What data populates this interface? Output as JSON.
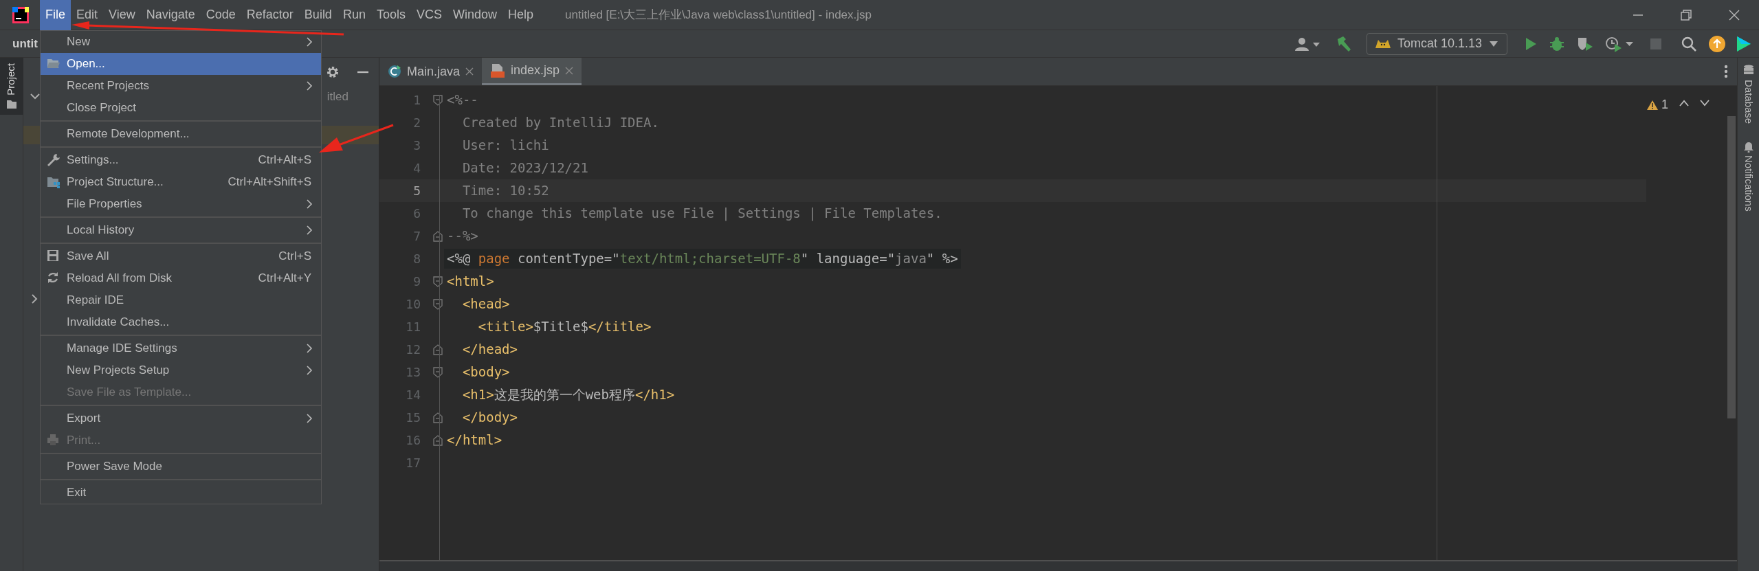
{
  "title_bar": {
    "menus": [
      {
        "label": "File",
        "selected": true
      },
      {
        "label": "Edit",
        "selected": false
      },
      {
        "label": "View",
        "selected": false
      },
      {
        "label": "Navigate",
        "selected": false
      },
      {
        "label": "Code",
        "selected": false
      },
      {
        "label": "Refactor",
        "selected": false
      },
      {
        "label": "Build",
        "selected": false
      },
      {
        "label": "Run",
        "selected": false
      },
      {
        "label": "Tools",
        "selected": false
      },
      {
        "label": "VCS",
        "selected": false
      },
      {
        "label": "Window",
        "selected": false
      },
      {
        "label": "Help",
        "selected": false
      }
    ],
    "title": "untitled [E:\\大三上作业\\Java web\\class1\\untitled] - index.jsp"
  },
  "toolbar": {
    "project_name": "untit",
    "run_config": "Tomcat 10.1.13"
  },
  "left_strip": {
    "label": "Project"
  },
  "project_panel": {
    "visible_text": "itled"
  },
  "tabs": [
    {
      "label": "Main.java",
      "kind": "java",
      "selected": false
    },
    {
      "label": "index.jsp",
      "kind": "jsp",
      "selected": true
    }
  ],
  "editor": {
    "warning_count": "1",
    "lines": [
      {
        "number": "1",
        "current": false,
        "shaded": false,
        "fold_start": true,
        "fold_end": false,
        "tokens": [
          {
            "kind": "comment",
            "text": "<%--"
          }
        ]
      },
      {
        "number": "2",
        "current": false,
        "shaded": false,
        "fold_start": false,
        "fold_end": false,
        "tokens": [
          {
            "kind": "comment",
            "text": "  Created by IntelliJ IDEA."
          }
        ]
      },
      {
        "number": "3",
        "current": false,
        "shaded": false,
        "fold_start": false,
        "fold_end": false,
        "tokens": [
          {
            "kind": "comment",
            "text": "  User: lichi"
          }
        ]
      },
      {
        "number": "4",
        "current": false,
        "shaded": false,
        "fold_start": false,
        "fold_end": false,
        "tokens": [
          {
            "kind": "comment",
            "text": "  Date: 2023/12/21"
          }
        ]
      },
      {
        "number": "5",
        "current": true,
        "shaded": false,
        "fold_start": false,
        "fold_end": false,
        "tokens": [
          {
            "kind": "comment",
            "text": "  Time: 10:52"
          }
        ]
      },
      {
        "number": "6",
        "current": false,
        "shaded": false,
        "fold_start": false,
        "fold_end": false,
        "tokens": [
          {
            "kind": "comment",
            "text": "  To change this template use File | Settings | File Templates."
          }
        ]
      },
      {
        "number": "7",
        "current": false,
        "shaded": false,
        "fold_start": false,
        "fold_end": true,
        "tokens": [
          {
            "kind": "comment",
            "text": "--%>"
          }
        ]
      },
      {
        "number": "8",
        "current": false,
        "shaded": true,
        "fold_start": false,
        "fold_end": false,
        "tokens": [
          {
            "kind": "plain",
            "text": "<%@ "
          },
          {
            "kind": "keyword",
            "text": "page"
          },
          {
            "kind": "plain",
            "text": " contentType=\""
          },
          {
            "kind": "string",
            "text": "text/html;charset=UTF-8"
          },
          {
            "kind": "plain",
            "text": "\" language=\""
          },
          {
            "kind": "muted",
            "text": "java"
          },
          {
            "kind": "plain",
            "text": "\" %>"
          }
        ]
      },
      {
        "number": "9",
        "current": false,
        "shaded": false,
        "fold_start": true,
        "fold_end": false,
        "tokens": [
          {
            "kind": "tag",
            "text": "<html>"
          }
        ]
      },
      {
        "number": "10",
        "current": false,
        "shaded": false,
        "fold_start": true,
        "fold_end": false,
        "tokens": [
          {
            "kind": "tag",
            "text": "  <head>"
          }
        ]
      },
      {
        "number": "11",
        "current": false,
        "shaded": false,
        "fold_start": false,
        "fold_end": false,
        "tokens": [
          {
            "kind": "tag",
            "text": "    <title>"
          },
          {
            "kind": "plain",
            "text": "$Title$"
          },
          {
            "kind": "tag",
            "text": "</title>"
          }
        ]
      },
      {
        "number": "12",
        "current": false,
        "shaded": false,
        "fold_start": false,
        "fold_end": true,
        "tokens": [
          {
            "kind": "tag",
            "text": "  </head>"
          }
        ]
      },
      {
        "number": "13",
        "current": false,
        "shaded": false,
        "fold_start": true,
        "fold_end": false,
        "tokens": [
          {
            "kind": "tag",
            "text": "  <body>"
          }
        ]
      },
      {
        "number": "14",
        "current": false,
        "shaded": false,
        "fold_start": false,
        "fold_end": false,
        "tokens": [
          {
            "kind": "tag",
            "text": "  <h1>"
          },
          {
            "kind": "plain",
            "text": "这是我的第一个web程序"
          },
          {
            "kind": "tag",
            "text": "</h1>"
          }
        ]
      },
      {
        "number": "15",
        "current": false,
        "shaded": false,
        "fold_start": false,
        "fold_end": true,
        "tokens": [
          {
            "kind": "tag",
            "text": "  </body>"
          }
        ]
      },
      {
        "number": "16",
        "current": false,
        "shaded": false,
        "fold_start": false,
        "fold_end": true,
        "tokens": [
          {
            "kind": "tag",
            "text": "</html>"
          }
        ]
      },
      {
        "number": "17",
        "current": false,
        "shaded": false,
        "fold_start": false,
        "fold_end": false
      }
    ]
  },
  "right_strip": {
    "labels": [
      "Database",
      "Notifications"
    ]
  },
  "file_menu": {
    "groups": [
      [
        {
          "label": "New",
          "submenu": true,
          "disabled": false,
          "selected": false
        },
        {
          "label": "Open...",
          "submenu": false,
          "disabled": false,
          "selected": true
        },
        {
          "label": "Recent Projects",
          "submenu": true,
          "disabled": false,
          "selected": false
        },
        {
          "label": "Close Project",
          "submenu": false,
          "disabled": false,
          "selected": false
        }
      ],
      [
        {
          "label": "Remote Development...",
          "submenu": false,
          "disabled": false,
          "selected": false
        }
      ],
      [
        {
          "label": "Settings...",
          "shortcut": "Ctrl+Alt+S",
          "submenu": false,
          "disabled": false,
          "selected": false
        },
        {
          "label": "Project Structure...",
          "shortcut": "Ctrl+Alt+Shift+S",
          "submenu": false,
          "disabled": false,
          "selected": false
        },
        {
          "label": "File Properties",
          "submenu": true,
          "disabled": false,
          "selected": false
        }
      ],
      [
        {
          "label": "Local History",
          "submenu": true,
          "disabled": false,
          "selected": false
        }
      ],
      [
        {
          "label": "Save All",
          "shortcut": "Ctrl+S",
          "submenu": false,
          "disabled": false,
          "selected": false
        },
        {
          "label": "Reload All from Disk",
          "shortcut": "Ctrl+Alt+Y",
          "submenu": false,
          "disabled": false,
          "selected": false
        },
        {
          "label": "Repair IDE",
          "submenu": false,
          "disabled": false,
          "selected": false
        },
        {
          "label": "Invalidate Caches...",
          "submenu": false,
          "disabled": false,
          "selected": false
        }
      ],
      [
        {
          "label": "Manage IDE Settings",
          "submenu": true,
          "disabled": false,
          "selected": false
        },
        {
          "label": "New Projects Setup",
          "submenu": true,
          "disabled": false,
          "selected": false
        },
        {
          "label": "Save File as Template...",
          "submenu": false,
          "disabled": true,
          "selected": false
        }
      ],
      [
        {
          "label": "Export",
          "submenu": true,
          "disabled": false,
          "selected": false
        },
        {
          "label": "Print...",
          "submenu": false,
          "disabled": true,
          "selected": false
        }
      ],
      [
        {
          "label": "Power Save Mode",
          "submenu": false,
          "disabled": false,
          "selected": false
        }
      ],
      [
        {
          "label": "Exit",
          "submenu": false,
          "disabled": false,
          "selected": false
        }
      ]
    ]
  }
}
